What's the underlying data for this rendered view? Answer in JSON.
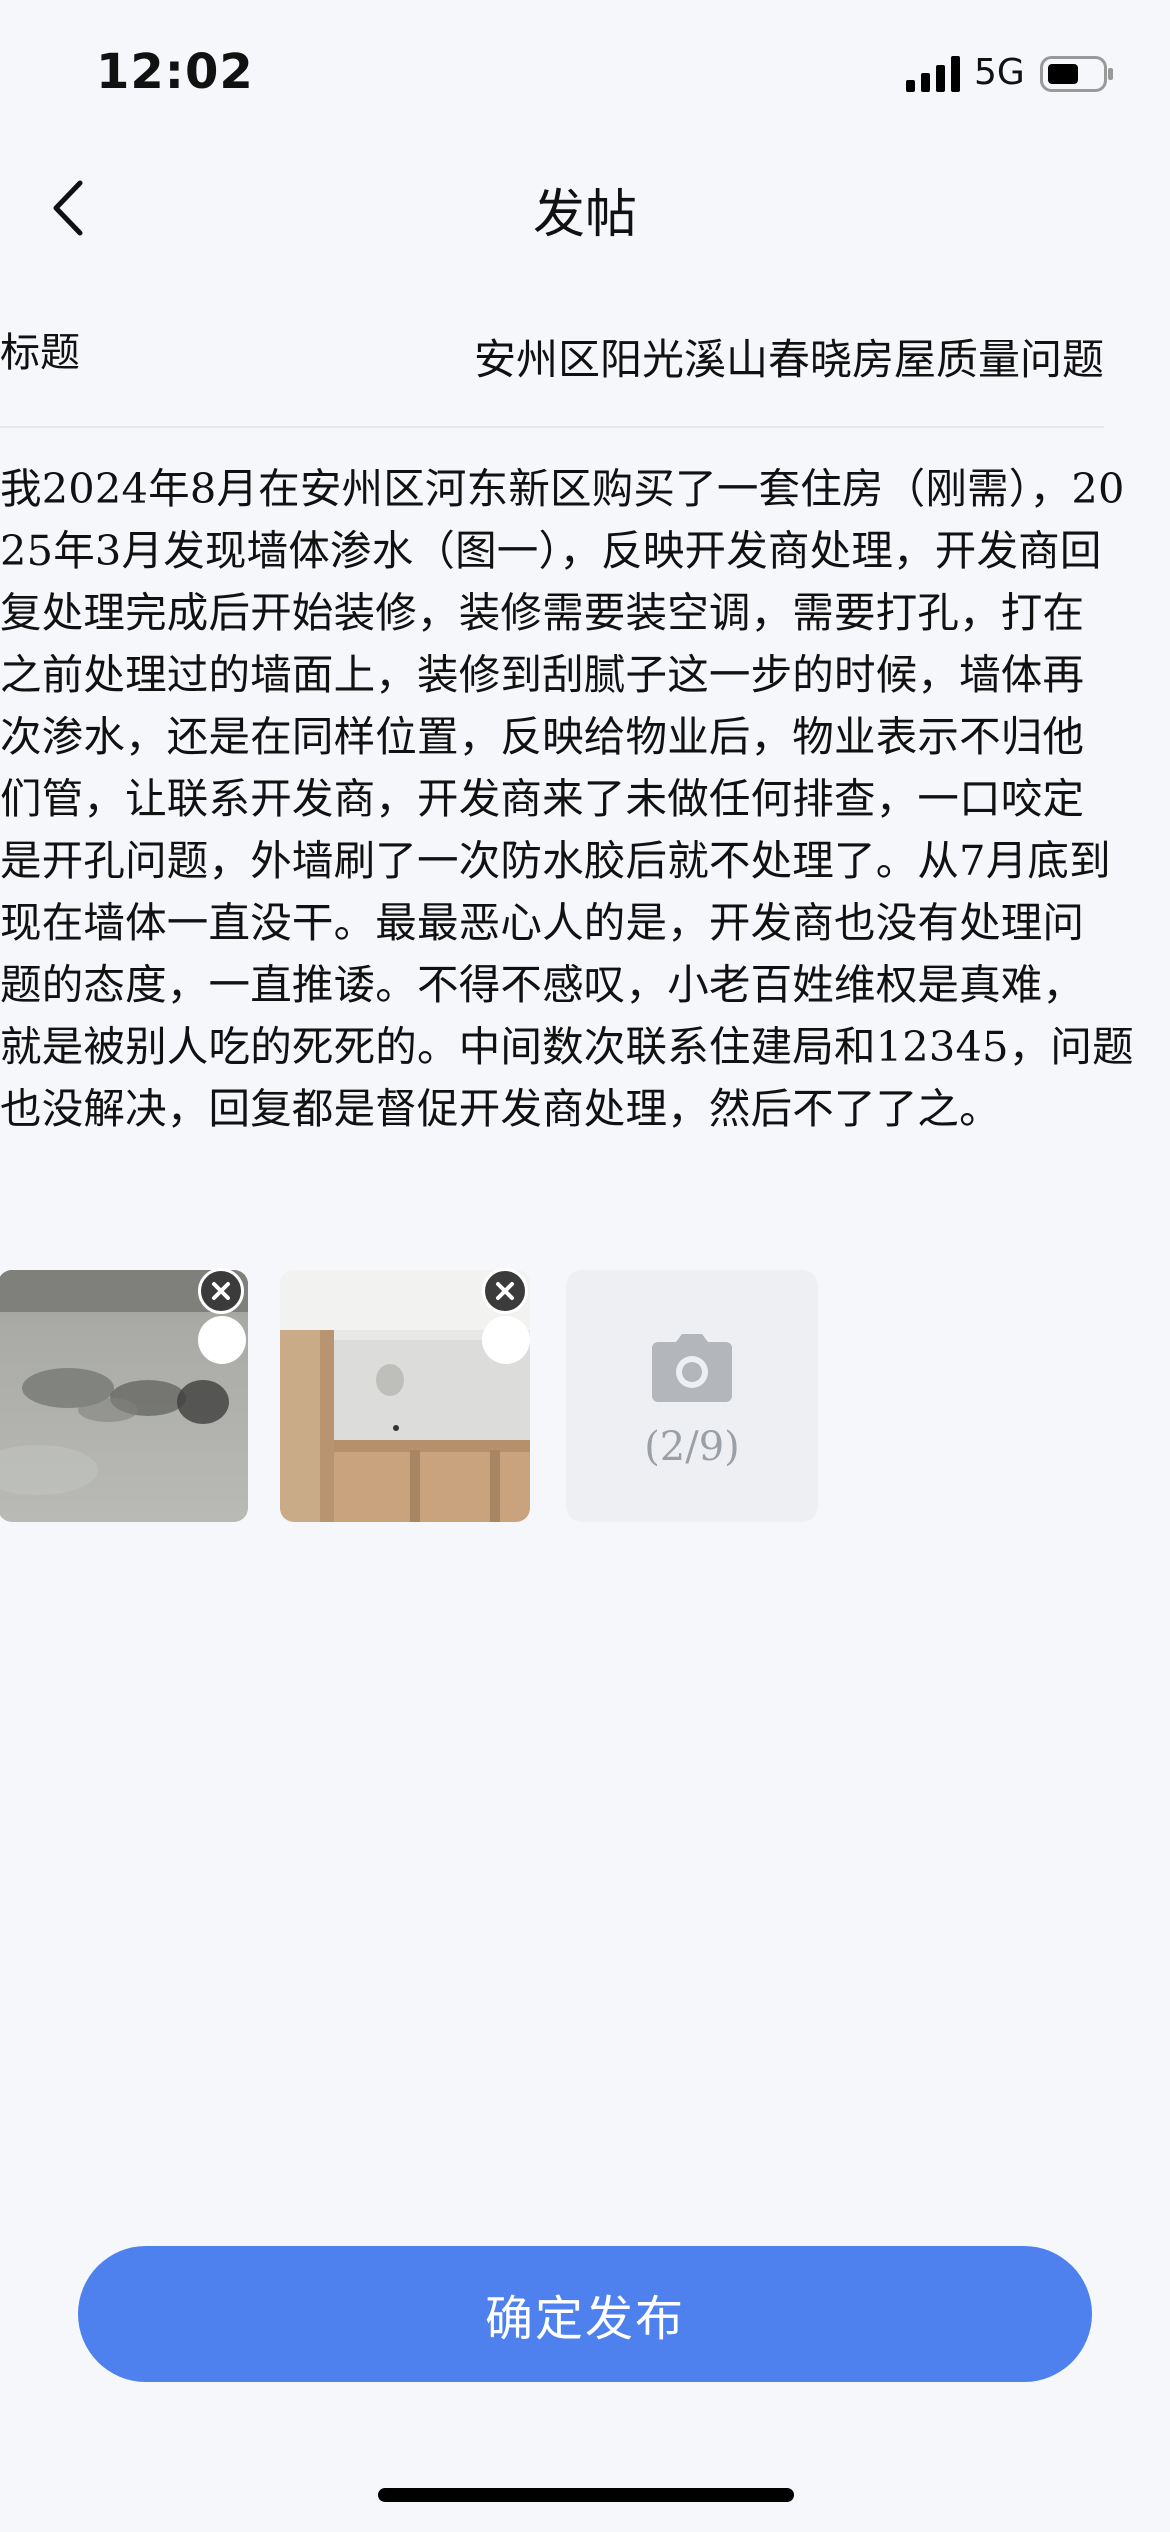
{
  "status_bar": {
    "time": "12:02",
    "network": "5G"
  },
  "nav": {
    "title": "发帖",
    "back_icon": "chevron-left-icon"
  },
  "form": {
    "title_label": "标题",
    "title_value": "安州区阳光溪山春晓房屋质量问题",
    "body_lines": [
      "我2024年8月在安州区河东新区购买了一套住房（刚需），20",
      "25年3月发现墙体渗水（图一），反映开发商处理，开发商回",
      "复处理完成后开始装修，装修需要装空调，需要打孔，打在",
      "之前处理过的墙面上，装修到刮腻子这一步的时候，墙体再",
      "次渗水，还是在同样位置，反映给物业后，物业表示不归他",
      "们管，让联系开发商，开发商来了未做任何排查，一口咬定",
      "是开孔问题，外墙刷了一次防水胶后就不处理了。从7月底到",
      "现在墙体一直没干。最最恶心人的是，开发商也没有处理问",
      "题的态度，一直推诿。不得不感叹，小老百姓维权是真难，",
      "就是被别人吃的死死的。中间数次联系住建局和12345，问题",
      "也没解决，回复都是督促开发商处理，然后不了了之。"
    ]
  },
  "photos": {
    "count_label": "(2/9)",
    "add_icon": "camera-icon",
    "remove_icon": "close-icon"
  },
  "submit_label": "确定发布",
  "colors": {
    "accent": "#4f81ee",
    "background": "#f6f7fb",
    "add_tile": "#eeeff2"
  }
}
